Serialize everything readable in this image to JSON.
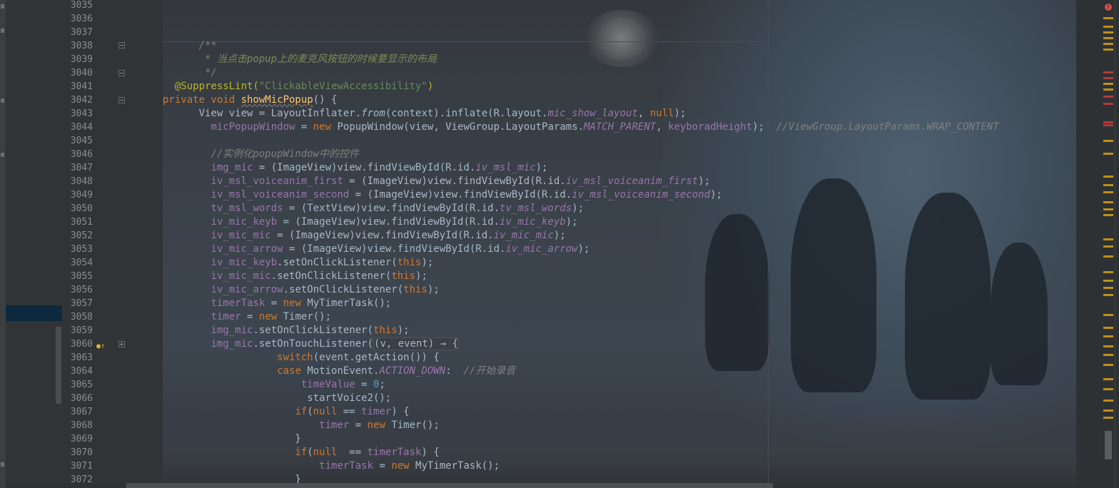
{
  "editor": {
    "line_numbers": [
      "3035",
      "3036",
      "3037",
      "3038",
      "3039",
      "3040",
      "3041",
      "3042",
      "3043",
      "3044",
      "3045",
      "3046",
      "3047",
      "3048",
      "3049",
      "3050",
      "3051",
      "3052",
      "3053",
      "3054",
      "3055",
      "3056",
      "3057",
      "3058",
      "3059",
      "3060",
      "3063",
      "3064",
      "3065",
      "3066",
      "3067",
      "3068",
      "3069",
      "3070",
      "3071",
      "3072"
    ],
    "lines": [
      [],
      [],
      [],
      [
        {
          "t": "      /**",
          "c": "cm"
        }
      ],
      [
        {
          "t": "       * 当点击",
          "c": "cmp"
        },
        {
          "t": "popup",
          "c": "cmp it"
        },
        {
          "t": "上的麦克风按钮的时候要显示的布局",
          "c": "cmp"
        }
      ],
      [
        {
          "t": "       */",
          "c": "cm"
        }
      ],
      [
        {
          "t": "  @SuppressLint(",
          "c": "ann"
        },
        {
          "t": "\"ClickableViewAccessibility\"",
          "c": "str"
        },
        {
          "t": ")",
          "c": "ann"
        }
      ],
      [
        {
          "t": "private void ",
          "c": "kw"
        },
        {
          "t": "showMicPopup",
          "c": "mth und"
        },
        {
          "t": "() {",
          "c": ""
        }
      ],
      [
        {
          "t": "      View view = LayoutInflater.",
          "c": ""
        },
        {
          "t": "from",
          "c": "it"
        },
        {
          "t": "(context).inflate(R.layout.",
          "c": ""
        },
        {
          "t": "mic_show_layout",
          "c": "fld"
        },
        {
          "t": ", ",
          "c": ""
        },
        {
          "t": "null",
          "c": "kw"
        },
        {
          "t": ");",
          "c": ""
        }
      ],
      [
        {
          "t": "        ",
          "c": ""
        },
        {
          "t": "micPopupWindow",
          "c": "var"
        },
        {
          "t": " = ",
          "c": ""
        },
        {
          "t": "new ",
          "c": "kw"
        },
        {
          "t": "PopupWindow(view, ViewGroup.LayoutParams.",
          "c": ""
        },
        {
          "t": "MATCH_PARENT",
          "c": "fld"
        },
        {
          "t": ", ",
          "c": ""
        },
        {
          "t": "keyboradHeight",
          "c": "var"
        },
        {
          "t": ");  ",
          "c": ""
        },
        {
          "t": "//ViewGroup.LayoutParams.WRAP_CONTENT",
          "c": "cm"
        }
      ],
      [],
      [
        {
          "t": "        ",
          "c": ""
        },
        {
          "t": "//实例化popupWindow中的控件",
          "c": "cm"
        }
      ],
      [
        {
          "t": "        ",
          "c": ""
        },
        {
          "t": "img_mic",
          "c": "var"
        },
        {
          "t": " = (ImageView)view.findViewById(R.id.",
          "c": ""
        },
        {
          "t": "iv_msl_mic",
          "c": "fld"
        },
        {
          "t": ");",
          "c": ""
        }
      ],
      [
        {
          "t": "        ",
          "c": ""
        },
        {
          "t": "iv_msl_voiceanim_first",
          "c": "var"
        },
        {
          "t": " = (ImageView)view.findViewById(R.id.",
          "c": ""
        },
        {
          "t": "iv_msl_voiceanim_first",
          "c": "fld"
        },
        {
          "t": ");",
          "c": ""
        }
      ],
      [
        {
          "t": "        ",
          "c": ""
        },
        {
          "t": "iv_msl_voiceanim_second",
          "c": "var"
        },
        {
          "t": " = (ImageView)view.findViewById(R.id.",
          "c": ""
        },
        {
          "t": "iv_msl_voiceanim_second",
          "c": "fld"
        },
        {
          "t": ");",
          "c": ""
        }
      ],
      [
        {
          "t": "        ",
          "c": ""
        },
        {
          "t": "tv_msl_words",
          "c": "var"
        },
        {
          "t": " = (TextView)view.findViewById(R.id.",
          "c": ""
        },
        {
          "t": "tv_msl_words",
          "c": "fld"
        },
        {
          "t": ");",
          "c": ""
        }
      ],
      [
        {
          "t": "        ",
          "c": ""
        },
        {
          "t": "iv_mic_keyb",
          "c": "var"
        },
        {
          "t": " = (ImageView)view.findViewById(R.id.",
          "c": ""
        },
        {
          "t": "iv_mic_keyb",
          "c": "fld"
        },
        {
          "t": ");",
          "c": ""
        }
      ],
      [
        {
          "t": "        ",
          "c": ""
        },
        {
          "t": "iv_mic_mic",
          "c": "var"
        },
        {
          "t": " = (ImageView)view.findViewById(R.id.",
          "c": ""
        },
        {
          "t": "iv_mic_mic",
          "c": "fld"
        },
        {
          "t": ");",
          "c": ""
        }
      ],
      [
        {
          "t": "        ",
          "c": ""
        },
        {
          "t": "iv_mic_arrow",
          "c": "var"
        },
        {
          "t": " = (ImageView)view.findViewById(R.id.",
          "c": ""
        },
        {
          "t": "iv_mic_arrow",
          "c": "fld"
        },
        {
          "t": ");",
          "c": ""
        }
      ],
      [
        {
          "t": "        ",
          "c": ""
        },
        {
          "t": "iv_mic_keyb",
          "c": "var"
        },
        {
          "t": ".setOnClickListener(",
          "c": ""
        },
        {
          "t": "this",
          "c": "kw"
        },
        {
          "t": ");",
          "c": ""
        }
      ],
      [
        {
          "t": "        ",
          "c": ""
        },
        {
          "t": "iv_mic_mic",
          "c": "var"
        },
        {
          "t": ".setOnClickListener(",
          "c": ""
        },
        {
          "t": "this",
          "c": "kw"
        },
        {
          "t": ");",
          "c": ""
        }
      ],
      [
        {
          "t": "        ",
          "c": ""
        },
        {
          "t": "iv_mic_arrow",
          "c": "var"
        },
        {
          "t": ".setOnClickListener(",
          "c": ""
        },
        {
          "t": "this",
          "c": "kw"
        },
        {
          "t": ");",
          "c": ""
        }
      ],
      [
        {
          "t": "        ",
          "c": ""
        },
        {
          "t": "timerTask",
          "c": "var"
        },
        {
          "t": " = ",
          "c": ""
        },
        {
          "t": "new ",
          "c": "kw"
        },
        {
          "t": "MyTimerTask();",
          "c": ""
        }
      ],
      [
        {
          "t": "        ",
          "c": ""
        },
        {
          "t": "timer",
          "c": "var"
        },
        {
          "t": " = ",
          "c": ""
        },
        {
          "t": "new ",
          "c": "kw"
        },
        {
          "t": "Timer();",
          "c": ""
        }
      ],
      [
        {
          "t": "        ",
          "c": ""
        },
        {
          "t": "img_mic",
          "c": "var"
        },
        {
          "t": ".setOnClickListener(",
          "c": ""
        },
        {
          "t": "this",
          "c": "kw"
        },
        {
          "t": ");",
          "c": ""
        }
      ],
      [
        {
          "t": "        ",
          "c": ""
        },
        {
          "t": "img_mic",
          "c": "var"
        },
        {
          "t": ".setOnTouchListener(",
          "c": ""
        },
        {
          "t": "(v, event) → {",
          "c": "fold-hint"
        }
      ],
      [
        {
          "t": "                   ",
          "c": ""
        },
        {
          "t": "switch",
          "c": "kw"
        },
        {
          "t": "(event.getAction()) {",
          "c": ""
        }
      ],
      [
        {
          "t": "                   ",
          "c": ""
        },
        {
          "t": "case ",
          "c": "kw"
        },
        {
          "t": "MotionEvent.",
          "c": ""
        },
        {
          "t": "ACTION_DOWN",
          "c": "fld"
        },
        {
          "t": ":  ",
          "c": ""
        },
        {
          "t": "//开始录音",
          "c": "cm"
        }
      ],
      [
        {
          "t": "                       ",
          "c": ""
        },
        {
          "t": "timeValue",
          "c": "var"
        },
        {
          "t": " = ",
          "c": ""
        },
        {
          "t": "0",
          "c": "num"
        },
        {
          "t": ";",
          "c": ""
        }
      ],
      [
        {
          "t": "                        startVoice2();",
          "c": ""
        }
      ],
      [
        {
          "t": "                      ",
          "c": ""
        },
        {
          "t": "if",
          "c": "kw"
        },
        {
          "t": "(",
          "c": ""
        },
        {
          "t": "null",
          "c": "kw"
        },
        {
          "t": " == ",
          "c": ""
        },
        {
          "t": "timer",
          "c": "var"
        },
        {
          "t": ") {",
          "c": ""
        }
      ],
      [
        {
          "t": "                          ",
          "c": ""
        },
        {
          "t": "timer",
          "c": "var"
        },
        {
          "t": " = ",
          "c": ""
        },
        {
          "t": "new ",
          "c": "kw"
        },
        {
          "t": "Timer();",
          "c": ""
        }
      ],
      [
        {
          "t": "                      }",
          "c": ""
        }
      ],
      [
        {
          "t": "                      ",
          "c": ""
        },
        {
          "t": "if",
          "c": "kw"
        },
        {
          "t": "(",
          "c": ""
        },
        {
          "t": "null",
          "c": "kw"
        },
        {
          "t": "  == ",
          "c": ""
        },
        {
          "t": "timerTask",
          "c": "var"
        },
        {
          "t": ") {",
          "c": ""
        }
      ],
      [
        {
          "t": "                          ",
          "c": ""
        },
        {
          "t": "timerTask",
          "c": "var"
        },
        {
          "t": " = ",
          "c": ""
        },
        {
          "t": "new ",
          "c": "kw"
        },
        {
          "t": "MyTimerTask();",
          "c": ""
        }
      ],
      [
        {
          "t": "                      }",
          "c": ""
        }
      ]
    ]
  },
  "colors": {
    "keyword": "#cc7832",
    "comment": "#808080",
    "annotation": "#bbb529",
    "string": "#6a8759",
    "field": "#9876aa",
    "method": "#ffc66d",
    "number": "#6897bb",
    "error_marker": "#d94c4c",
    "warning_marker": "#be9117"
  },
  "icons": {
    "error": "error-icon",
    "gutter_override": "override-method-icon"
  }
}
